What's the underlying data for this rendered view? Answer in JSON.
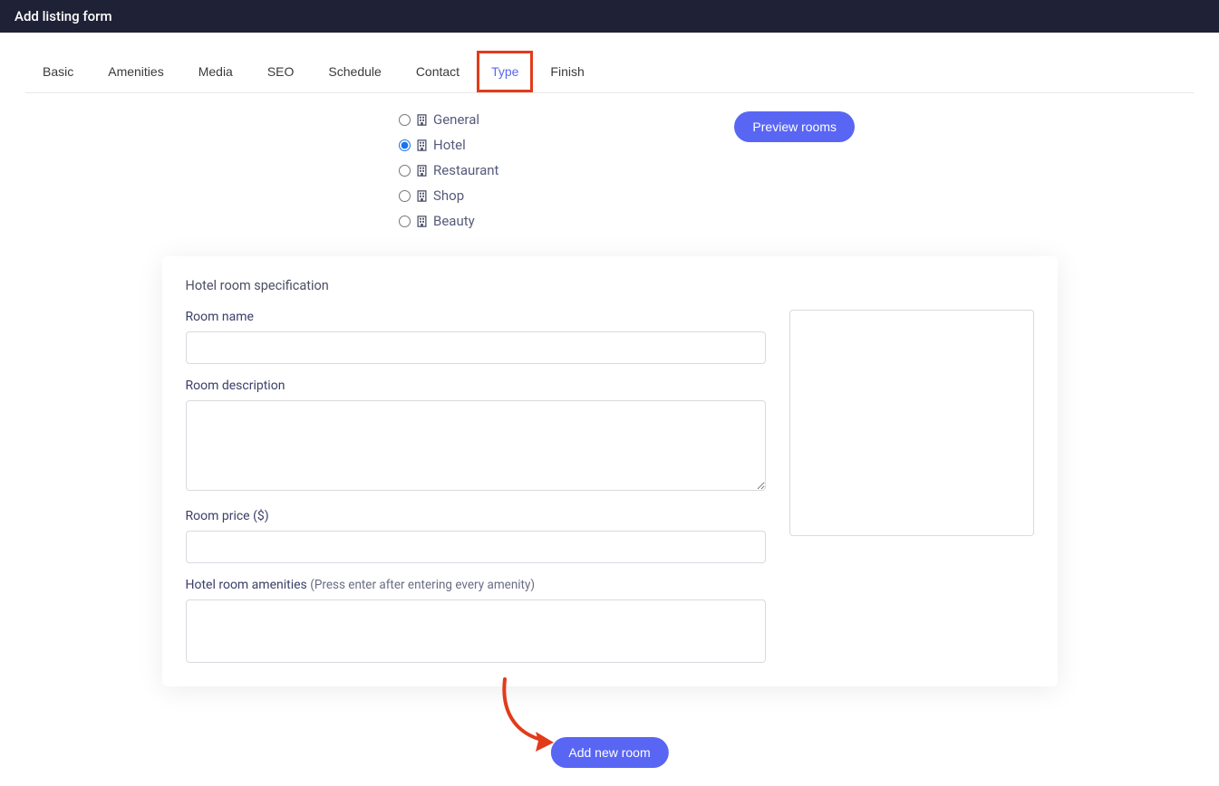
{
  "header": {
    "title": "Add listing form"
  },
  "tabs": [
    {
      "label": "Basic",
      "active": false
    },
    {
      "label": "Amenities",
      "active": false
    },
    {
      "label": "Media",
      "active": false
    },
    {
      "label": "SEO",
      "active": false
    },
    {
      "label": "Schedule",
      "active": false
    },
    {
      "label": "Contact",
      "active": false
    },
    {
      "label": "Type",
      "active": true
    },
    {
      "label": "Finish",
      "active": false
    }
  ],
  "types": [
    {
      "label": "General",
      "selected": false
    },
    {
      "label": "Hotel",
      "selected": true
    },
    {
      "label": "Restaurant",
      "selected": false
    },
    {
      "label": "Shop",
      "selected": false
    },
    {
      "label": "Beauty",
      "selected": false
    }
  ],
  "preview_button": "Preview rooms",
  "spec": {
    "card_title": "Hotel room specification",
    "room_name_label": "Room name",
    "room_name_value": "",
    "room_description_label": "Room description",
    "room_description_value": "",
    "room_price_label": "Room price ($)",
    "room_price_value": "",
    "amenities_label": "Hotel room amenities ",
    "amenities_hint": "(Press enter after entering every amenity)",
    "amenities_value": ""
  },
  "add_room_button": "Add new room",
  "colors": {
    "accent": "#5966f3",
    "annotation": "#e23b1a",
    "header_bg": "#1f2236"
  }
}
